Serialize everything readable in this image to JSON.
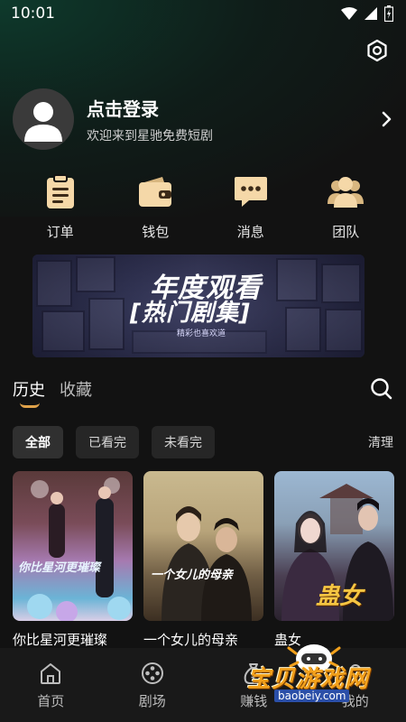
{
  "status_bar": {
    "time": "10:01"
  },
  "profile": {
    "title": "点击登录",
    "subtitle": "欢迎来到星驰免费短剧"
  },
  "quick_actions": [
    {
      "label": "订单",
      "icon": "clipboard-icon"
    },
    {
      "label": "钱包",
      "icon": "wallet-icon"
    },
    {
      "label": "消息",
      "icon": "message-icon"
    },
    {
      "label": "团队",
      "icon": "team-icon"
    }
  ],
  "banner": {
    "line1": "年度观看",
    "line2": "[热门剧集]",
    "sub": "精彩也喜欢道"
  },
  "tabs": {
    "history": "历史",
    "favorites": "收藏"
  },
  "filters": {
    "all": "全部",
    "watched": "已看完",
    "unwatched": "未看完",
    "clear": "清理"
  },
  "dramas": [
    {
      "title": "你比星河更璀璨",
      "poster_text": "你比星河更璀璨"
    },
    {
      "title": "一个女儿的母亲",
      "poster_text": "一个女儿的母亲"
    },
    {
      "title": "蛊女",
      "poster_text": "蛊女"
    }
  ],
  "bottom_nav": {
    "home": "首页",
    "theater": "剧场",
    "earn": "赚钱",
    "mine": "我的"
  },
  "watermark": {
    "text": "宝贝游戏网",
    "url": "baobeiy.com"
  },
  "colors": {
    "accent": "#e0a24a",
    "icon_gold": "#f5d8a8",
    "background": "#121212"
  }
}
